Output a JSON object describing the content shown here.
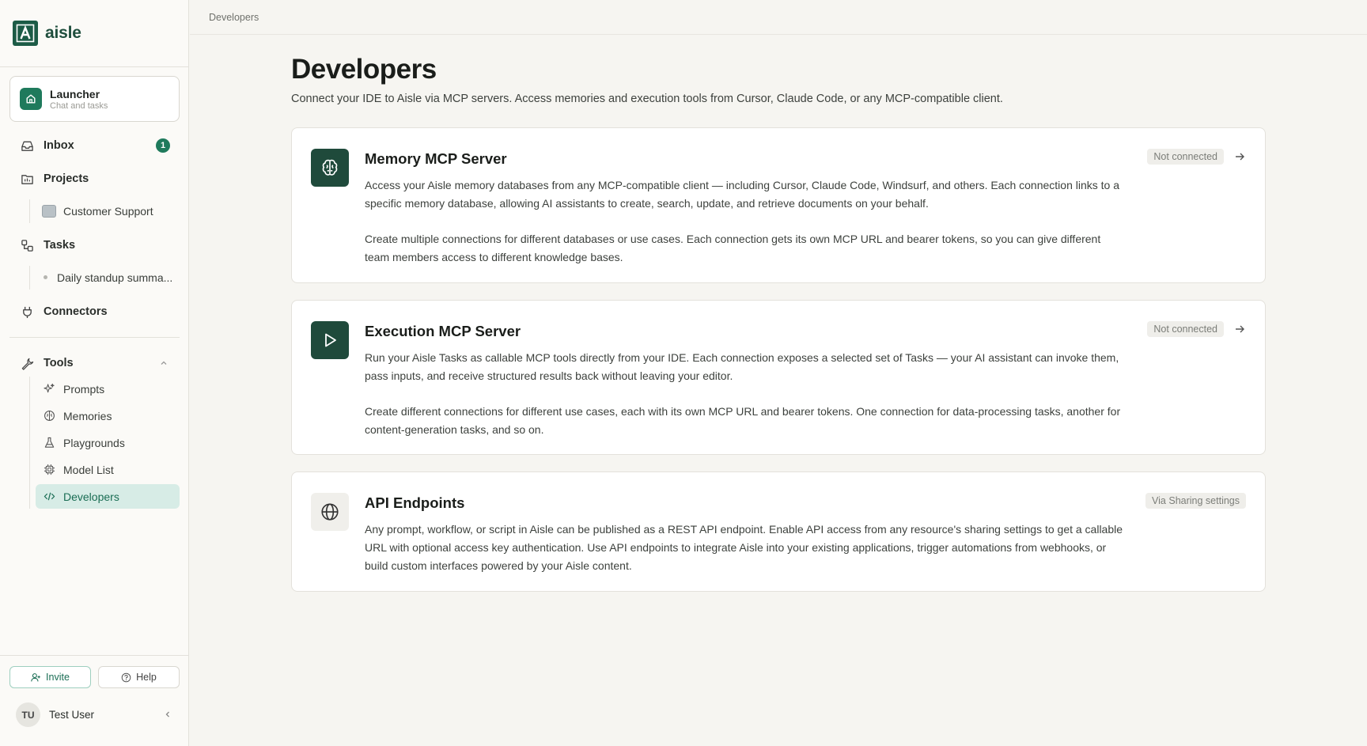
{
  "brand": {
    "name": "aisle",
    "accent": "#1f7a5c"
  },
  "sidebar": {
    "launcher": {
      "title": "Launcher",
      "subtitle": "Chat and tasks"
    },
    "inbox": {
      "label": "Inbox",
      "count": "1"
    },
    "projects": {
      "label": "Projects",
      "items": [
        "Customer Support"
      ]
    },
    "tasks": {
      "label": "Tasks",
      "items": [
        "Daily standup summa..."
      ]
    },
    "connectors": {
      "label": "Connectors"
    },
    "tools": {
      "label": "Tools",
      "items": [
        {
          "label": "Prompts",
          "icon": "sparkles-icon"
        },
        {
          "label": "Memories",
          "icon": "brain-icon"
        },
        {
          "label": "Playgrounds",
          "icon": "flask-icon"
        },
        {
          "label": "Model List",
          "icon": "chip-icon"
        },
        {
          "label": "Developers",
          "icon": "code-icon",
          "active": true
        }
      ]
    },
    "invite_label": "Invite",
    "help_label": "Help",
    "user": {
      "initials": "TU",
      "name": "Test User"
    }
  },
  "breadcrumb": "Developers",
  "page": {
    "title": "Developers",
    "subtitle": "Connect your IDE to Aisle via MCP servers. Access memories and execution tools from Cursor, Claude Code, or any MCP-compatible client."
  },
  "cards": [
    {
      "title": "Memory MCP Server",
      "status": "Not connected",
      "icon": "brain-icon",
      "paragraphs": [
        "Access your Aisle memory databases from any MCP-compatible client — including Cursor, Claude Code, Windsurf, and others. Each connection links to a specific memory database, allowing AI assistants to create, search, update, and retrieve documents on your behalf.",
        "Create multiple connections for different databases or use cases. Each connection gets its own MCP URL and bearer tokens, so you can give different team members access to different knowledge bases."
      ]
    },
    {
      "title": "Execution MCP Server",
      "status": "Not connected",
      "icon": "play-icon",
      "paragraphs": [
        "Run your Aisle Tasks as callable MCP tools directly from your IDE. Each connection exposes a selected set of Tasks — your AI assistant can invoke them, pass inputs, and receive structured results back without leaving your editor.",
        "Create different connections for different use cases, each with its own MCP URL and bearer tokens. One connection for data-processing tasks, another for content-generation tasks, and so on."
      ]
    },
    {
      "title": "API Endpoints",
      "status": "Via Sharing settings",
      "icon": "globe-icon",
      "paragraphs": [
        "Any prompt, workflow, or script in Aisle can be published as a REST API endpoint. Enable API access from any resource's sharing settings to get a callable URL with optional access key authentication. Use API endpoints to integrate Aisle into your existing applications, trigger automations from webhooks, or build custom interfaces powered by your Aisle content."
      ]
    }
  ]
}
